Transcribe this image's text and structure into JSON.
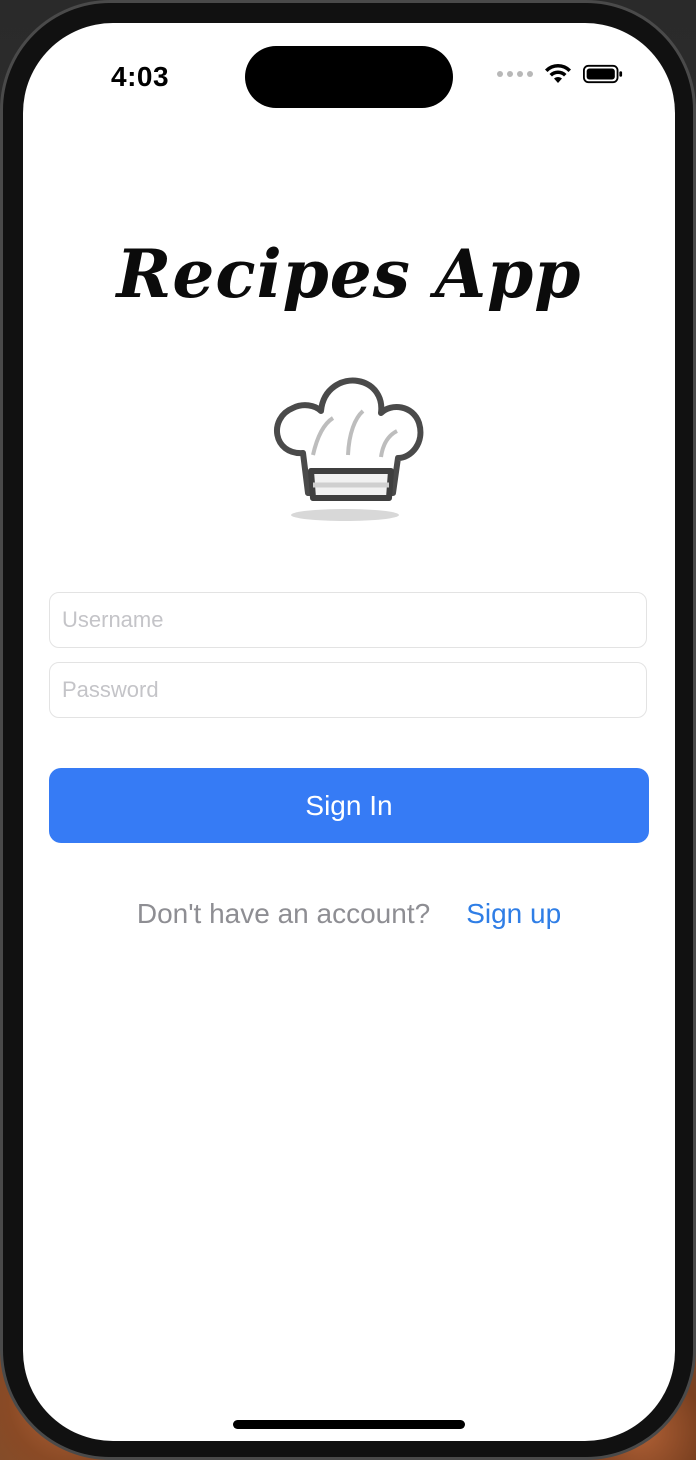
{
  "status_bar": {
    "time": "4:03",
    "icons": [
      "cellular-signal-icon",
      "wifi-icon",
      "battery-icon"
    ]
  },
  "app": {
    "title": "Recipes App",
    "logo_icon": "chef-hat-icon"
  },
  "form": {
    "username_placeholder": "Username",
    "username_value": "",
    "password_placeholder": "Password",
    "password_value": "",
    "signin_label": "Sign In"
  },
  "footer": {
    "prompt": "Don't have an account?",
    "signup_label": "Sign up"
  },
  "colors": {
    "accent": "#367bf5",
    "link": "#2f7ee6",
    "prompt_text": "#8e8e93",
    "background": "#ffffff"
  }
}
